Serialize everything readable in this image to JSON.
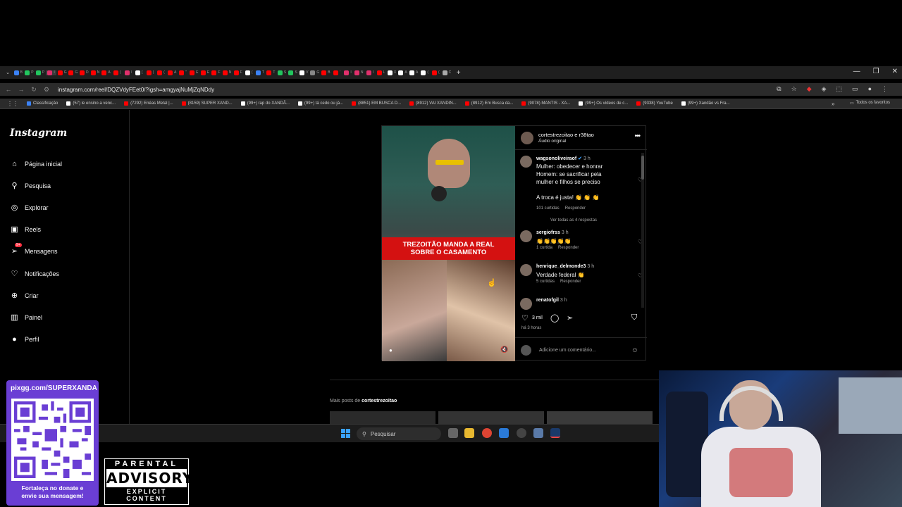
{
  "browser": {
    "url": "instagram.com/reel/DQZVdyFEet0/?igsh=amgyajNuMjZqNDdy",
    "tabs": [
      {
        "label": "B",
        "color": "#3b82f6"
      },
      {
        "label": "P",
        "color": "#22c55e"
      },
      {
        "label": "P",
        "color": "#22c55e"
      },
      {
        "label": "I",
        "color": "#e1306c"
      },
      {
        "label": "G",
        "color": "#ff0000"
      },
      {
        "label": "G",
        "color": "#ff0000"
      },
      {
        "label": "D",
        "color": "#ff0000"
      },
      {
        "label": "N",
        "color": "#ff0000"
      },
      {
        "label": "A",
        "color": "#ff0000"
      },
      {
        "label": "(",
        "color": "#ff0000"
      },
      {
        "label": "I",
        "color": "#e1306c"
      },
      {
        "label": "[",
        "color": "#ffffff"
      },
      {
        "label": "(",
        "color": "#ff0000"
      },
      {
        "label": "(",
        "color": "#ff0000"
      },
      {
        "label": "A",
        "color": "#ff0000"
      },
      {
        "label": "\"",
        "color": "#ff0000"
      },
      {
        "label": "E",
        "color": "#ff0000"
      },
      {
        "label": "E",
        "color": "#ff0000"
      },
      {
        "label": "F",
        "color": "#ff0000"
      },
      {
        "label": "N",
        "color": "#ff0000"
      },
      {
        "label": "F",
        "color": "#ff0000"
      },
      {
        "label": "(",
        "color": "#ffffff"
      },
      {
        "label": "T",
        "color": "#3b82f6"
      },
      {
        "label": "T",
        "color": "#ff0000"
      },
      {
        "label": "S",
        "color": "#22c55e"
      },
      {
        "label": "S",
        "color": "#22c55e"
      },
      {
        "label": "V",
        "color": "#ffffff"
      },
      {
        "label": "G",
        "color": "#888888"
      },
      {
        "label": "B",
        "color": "#ff0000"
      },
      {
        "label": "'",
        "color": "#ff0000"
      },
      {
        "label": "I",
        "color": "#e1306c"
      },
      {
        "label": "N",
        "color": "#e1306c"
      },
      {
        "label": "I",
        "color": "#e1306c"
      },
      {
        "label": "L",
        "color": "#ff0000"
      },
      {
        "label": "X",
        "color": "#ffffff"
      },
      {
        "label": "A",
        "color": "#ffffff"
      },
      {
        "label": "A",
        "color": "#ffffff"
      },
      {
        "label": "(",
        "color": "#ffffff"
      },
      {
        "label": "(",
        "color": "#ff0000"
      },
      {
        "label": "C",
        "color": "#aaaaaa"
      }
    ],
    "bookmarks": [
      {
        "label": "Classificação",
        "color": "#3b82f6"
      },
      {
        "label": "(57) le ensino a venc...",
        "color": "#ffffff"
      },
      {
        "label": "(7292) Enéas Metal |...",
        "color": "#ff0000"
      },
      {
        "label": "(8159) SUPER XAND...",
        "color": "#ff0000"
      },
      {
        "label": "(99+) rap do XANDÃ...",
        "color": "#ffffff"
      },
      {
        "label": "(99+) tá cedo ou já...",
        "color": "#ffffff"
      },
      {
        "label": "(8851) EM BUSCA D...",
        "color": "#ff0000"
      },
      {
        "label": "(8912) VAI XANDIN...",
        "color": "#ff0000"
      },
      {
        "label": "(8912) Em Busca da...",
        "color": "#ff0000"
      },
      {
        "label": "(9078) MANTIS - XA...",
        "color": "#ff0000"
      },
      {
        "label": "(99+) Os vídeos de c...",
        "color": "#ffffff"
      },
      {
        "label": "(9338) YouTube",
        "color": "#ff0000"
      },
      {
        "label": "(99+) Xandão vs Fra...",
        "color": "#ffffff"
      }
    ],
    "all_favorites": "Todos os favoritos"
  },
  "instagram": {
    "logo": "Instagram",
    "nav": [
      {
        "label": "Página inicial",
        "icon": "home-icon",
        "glyph": "⌂"
      },
      {
        "label": "Pesquisa",
        "icon": "search-icon",
        "glyph": "⚲"
      },
      {
        "label": "Explorar",
        "icon": "compass-icon",
        "glyph": "◎"
      },
      {
        "label": "Reels",
        "icon": "reels-icon",
        "glyph": "▣"
      },
      {
        "label": "Mensagens",
        "icon": "messages-icon",
        "glyph": "➢"
      },
      {
        "label": "Notificações",
        "icon": "heart-icon",
        "glyph": "♡"
      },
      {
        "label": "Criar",
        "icon": "plus-icon",
        "glyph": "⊕"
      },
      {
        "label": "Painel",
        "icon": "dashboard-icon",
        "glyph": "▥"
      },
      {
        "label": "Perfil",
        "icon": "profile-icon",
        "glyph": "●"
      }
    ],
    "messages_badge": "9+",
    "post": {
      "users": "cortestrezoitao e r38tao",
      "audio": "Áudio original",
      "video_banner": "TREZOITÃO MANDA A REAL\nSOBRE O CASAMENTO",
      "likes": "3 mil",
      "time_ago": "há 3 horas",
      "add_comment_placeholder": "Adicione um comentário...",
      "comments": [
        {
          "user": "wagsonoliveiraof",
          "verified": true,
          "time": "3 h",
          "text": "Mulher: obedecer e honrar\nHomem: se sacrificar pela\nmulher e filhos se preciso\n\nA troca é justa! 👏 👏 👏",
          "likes": "101 curtidas",
          "reply": "Responder",
          "view_replies": "Ver todas as 4 respostas"
        },
        {
          "user": "sergiofrss",
          "time": "3 h",
          "text": "👏👏👏👏👏",
          "likes": "1 curtida",
          "reply": "Responder"
        },
        {
          "user": "henrique_delmonde3",
          "time": "3 h",
          "text": "Verdade federal 👏",
          "likes": "5 curtidas",
          "reply": "Responder"
        },
        {
          "user": "renatofgil",
          "time": "3 h",
          "text": ""
        }
      ]
    },
    "more_posts_prefix": "Mais posts de",
    "more_posts_user": "cortestrezoitao"
  },
  "taskbar": {
    "search": "Pesquisar"
  },
  "overlay": {
    "qr_url": "pixgg.com/SUPERXANDA",
    "qr_message": "Fortaleça no donate e\nenvie sua mensagem!",
    "advisory_top": "PARENTAL",
    "advisory_mid": "ADVISORY",
    "advisory_bottom": "EXPLICIT CONTENT"
  }
}
